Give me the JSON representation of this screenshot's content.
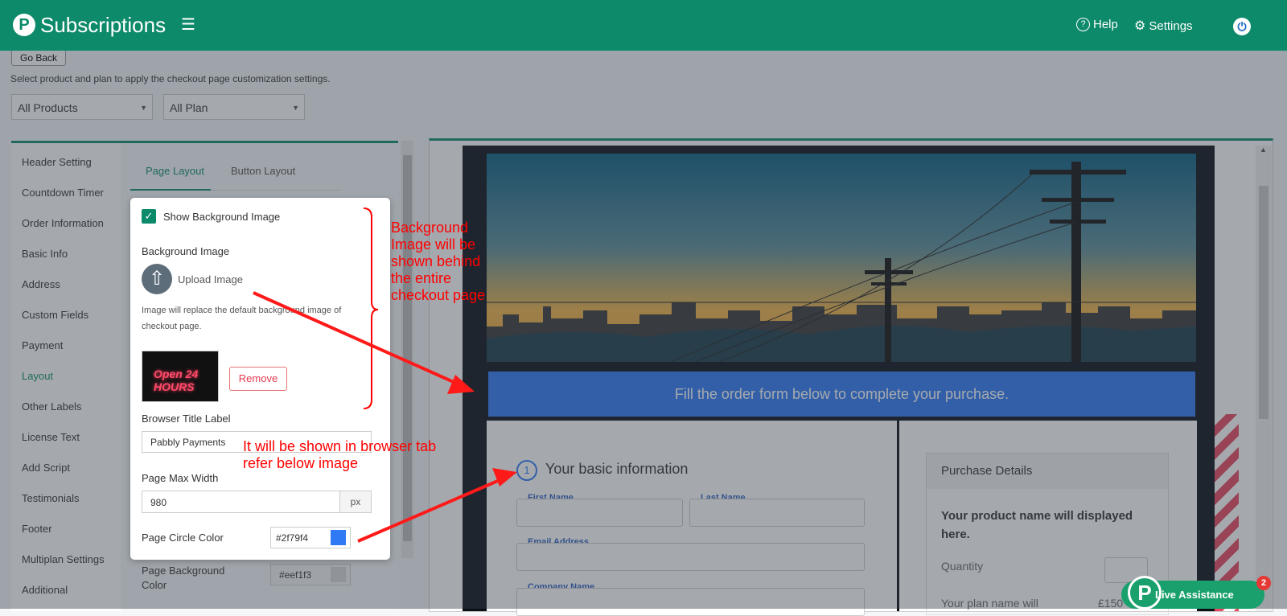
{
  "app": {
    "title": "Subscriptions",
    "logo_letter": "P"
  },
  "header": {
    "help_label": "Help",
    "settings_label": "Settings"
  },
  "page": {
    "go_back": "Go Back",
    "hint": "Select product and plan to apply the checkout page customization settings.",
    "product_select": "All Products",
    "plan_select": "All Plan"
  },
  "sidebar": {
    "items": [
      "Header Setting",
      "Countdown Timer",
      "Order Information",
      "Basic Info",
      "Address",
      "Custom Fields",
      "Payment",
      "Layout",
      "Other Labels",
      "License Text",
      "Add Script",
      "Testimonials",
      "Footer",
      "Multiplan Settings",
      "Additional"
    ]
  },
  "tabs": {
    "page_layout": "Page Layout",
    "button_layout": "Button Layout"
  },
  "card": {
    "show_bg_label": "Show Background Image",
    "bg_image_label": "Background Image",
    "upload_label": "Upload Image",
    "note": "Image will replace the default background image of checkout page.",
    "neon_text": "Open 24 HOURS",
    "remove_label": "Remove",
    "browser_title_label": "Browser Title Label",
    "browser_title_value": "Pabbly Payments",
    "max_width_label": "Page Max Width",
    "max_width_value": "980",
    "max_width_unit": "px",
    "circle_color_label": "Page Circle Color",
    "circle_color_value": "#2f79f4",
    "circle_color": "#2f79f4"
  },
  "below": {
    "bg_color_label": "Page Background Color",
    "bg_color_value": "#eef1f3"
  },
  "preview": {
    "banner_text": "Fill the order form below to complete your purchase.",
    "step_number": "1",
    "section_title": "Your basic information",
    "first_name": "First Name",
    "last_name": "Last Name",
    "email": "Email Address",
    "company": "Company Name",
    "purchase_details": "Purchase Details",
    "product_name": "Your product name will displayed here.",
    "quantity": "Quantity",
    "plan_name": "Your plan name will",
    "price": "£150"
  },
  "annotations": {
    "bg_note": "Background Image will be shown behind the entire checkout page",
    "title_note": "It will be shown in browser tab  refer below image"
  },
  "live": {
    "label": "Live Assistance",
    "badge": "2"
  }
}
